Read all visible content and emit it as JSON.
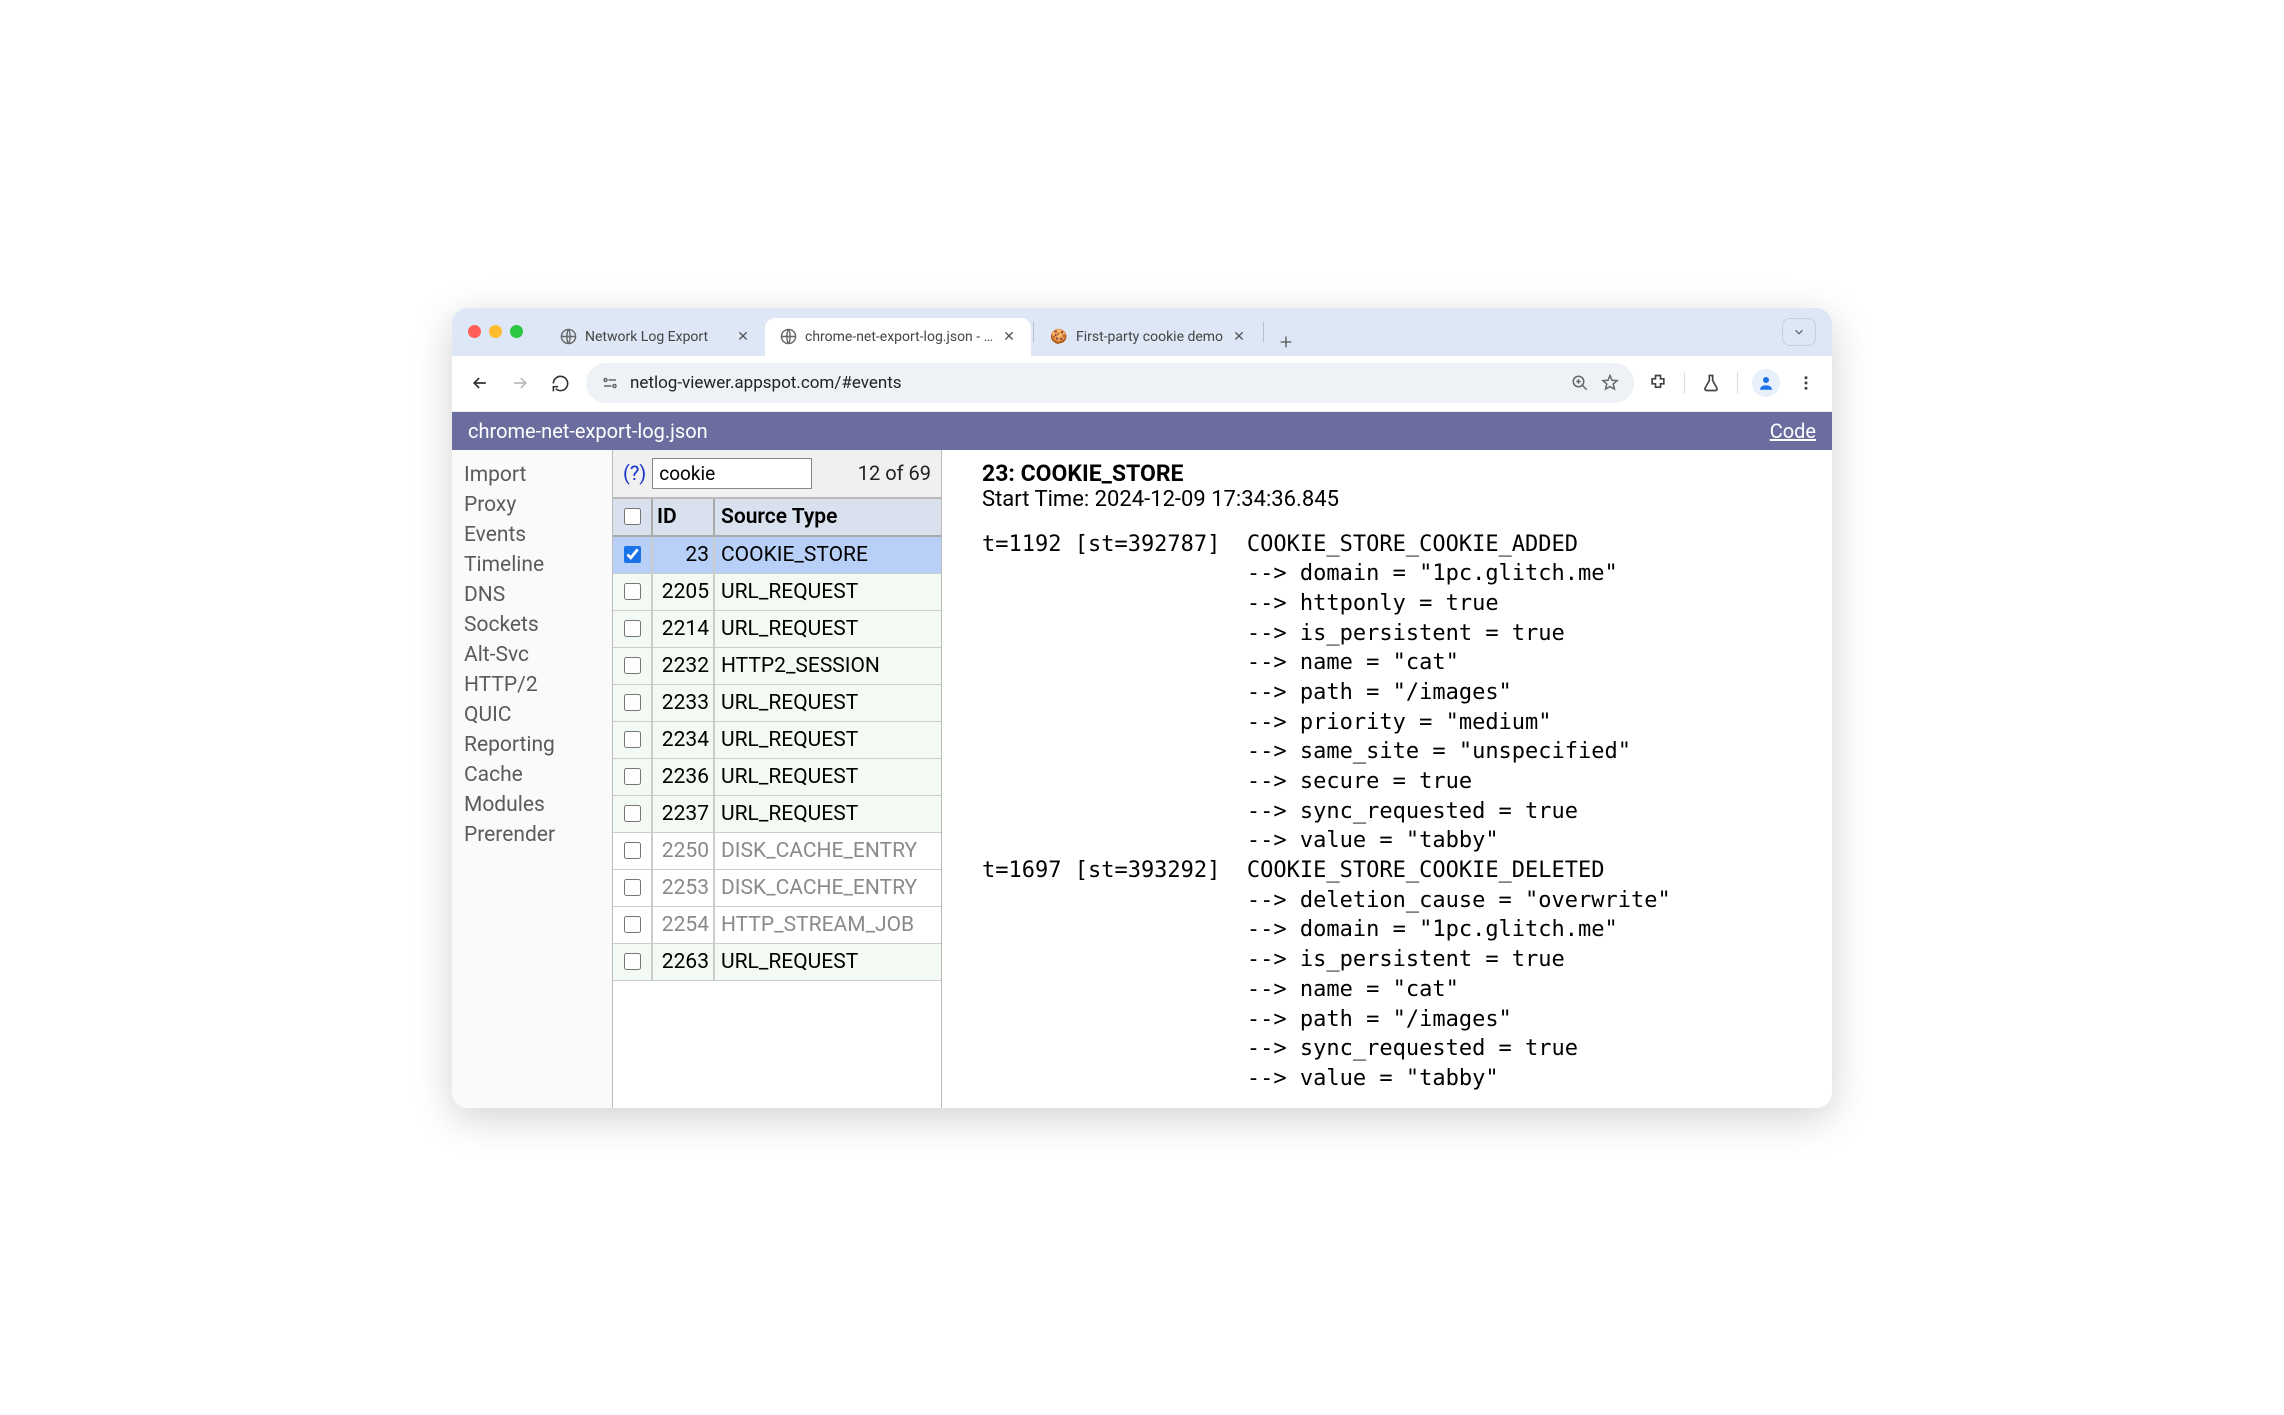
{
  "browser": {
    "tabs": [
      {
        "favicon": "globe",
        "label": "Network Log Export",
        "active": false
      },
      {
        "favicon": "globe",
        "label": "chrome-net-export-log.json - …",
        "active": true
      },
      {
        "favicon": "cookie",
        "label": "First-party cookie demo",
        "active": false
      }
    ],
    "url": "netlog-viewer.appspot.com/#events"
  },
  "appbar": {
    "filename": "chrome-net-export-log.json",
    "code_link": "Code"
  },
  "sidebar": {
    "items": [
      "Import",
      "Proxy",
      "Events",
      "Timeline",
      "DNS",
      "Sockets",
      "Alt-Svc",
      "HTTP/2",
      "QUIC",
      "Reporting",
      "Cache",
      "Modules",
      "Prerender"
    ]
  },
  "filter": {
    "help": "(?)",
    "value": "cookie",
    "count": "12 of 69"
  },
  "table": {
    "headers": {
      "id": "ID",
      "type": "Source Type"
    },
    "rows": [
      {
        "id": "23",
        "type": "COOKIE_STORE",
        "selected": true
      },
      {
        "id": "2205",
        "type": "URL_REQUEST"
      },
      {
        "id": "2214",
        "type": "URL_REQUEST"
      },
      {
        "id": "2232",
        "type": "HTTP2_SESSION"
      },
      {
        "id": "2233",
        "type": "URL_REQUEST"
      },
      {
        "id": "2234",
        "type": "URL_REQUEST"
      },
      {
        "id": "2236",
        "type": "URL_REQUEST"
      },
      {
        "id": "2237",
        "type": "URL_REQUEST"
      },
      {
        "id": "2250",
        "type": "DISK_CACHE_ENTRY",
        "inactive": true
      },
      {
        "id": "2253",
        "type": "DISK_CACHE_ENTRY",
        "inactive": true
      },
      {
        "id": "2254",
        "type": "HTTP_STREAM_JOB",
        "inactive": true
      },
      {
        "id": "2263",
        "type": "URL_REQUEST"
      }
    ]
  },
  "detail": {
    "title": "23: COOKIE_STORE",
    "start_time": "Start Time: 2024-12-09 17:34:36.845",
    "log": "t=1192 [st=392787]  COOKIE_STORE_COOKIE_ADDED\n                    --> domain = \"1pc.glitch.me\"\n                    --> httponly = true\n                    --> is_persistent = true\n                    --> name = \"cat\"\n                    --> path = \"/images\"\n                    --> priority = \"medium\"\n                    --> same_site = \"unspecified\"\n                    --> secure = true\n                    --> sync_requested = true\n                    --> value = \"tabby\"\nt=1697 [st=393292]  COOKIE_STORE_COOKIE_DELETED\n                    --> deletion_cause = \"overwrite\"\n                    --> domain = \"1pc.glitch.me\"\n                    --> is_persistent = true\n                    --> name = \"cat\"\n                    --> path = \"/images\"\n                    --> sync_requested = true\n                    --> value = \"tabby\""
  }
}
